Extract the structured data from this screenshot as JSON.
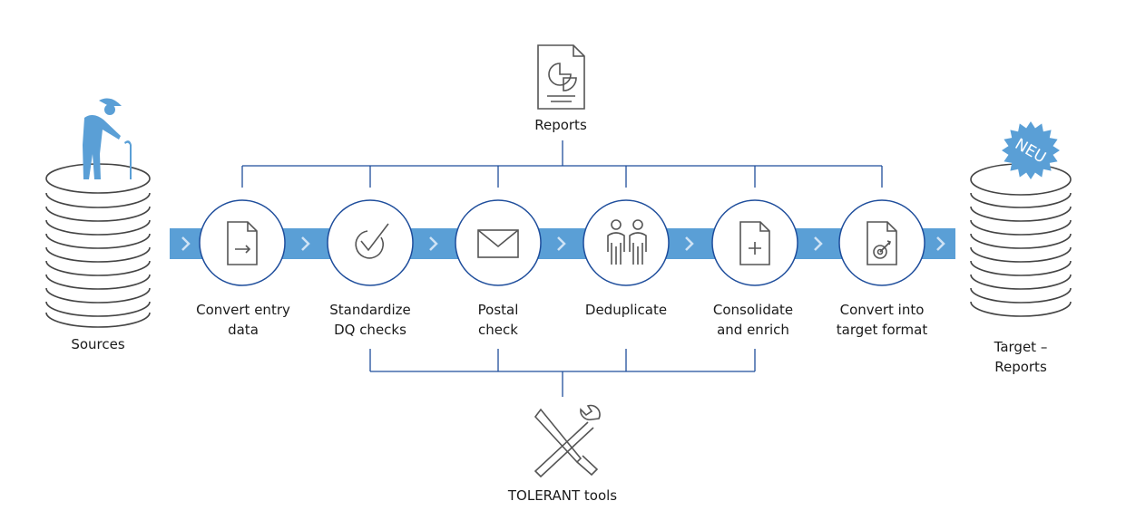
{
  "colors": {
    "accent": "#5a9fd6",
    "line": "#1f4e9c",
    "icon": "#555555"
  },
  "sources": {
    "label": "Sources",
    "icon": "elderly-person-icon"
  },
  "target": {
    "label_line1": "Target –",
    "label_line2": "Reports",
    "badge": "NEU"
  },
  "reports": {
    "label": "Reports",
    "icon": "report-document-icon"
  },
  "tools": {
    "label": "TOLERANT tools",
    "icon": "tools-icon"
  },
  "steps": [
    {
      "line1": "Convert entry",
      "line2": "data",
      "icon": "document-arrow-icon"
    },
    {
      "line1": "Standardize",
      "line2": "DQ checks",
      "icon": "check-icon"
    },
    {
      "line1": "Postal",
      "line2": "check",
      "icon": "envelope-icon"
    },
    {
      "line1": "Deduplicate",
      "line2": "",
      "icon": "two-people-icon"
    },
    {
      "line1": "Consolidate",
      "line2": "and enrich",
      "icon": "document-plus-icon"
    },
    {
      "line1": "Convert into",
      "line2": "target format",
      "icon": "document-target-icon"
    }
  ]
}
